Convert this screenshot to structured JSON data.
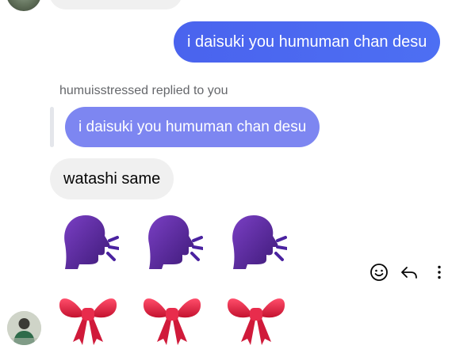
{
  "conversation": {
    "outgoing_message": "i daisuki you humuman chan desu",
    "reply_header": "humuisstressed replied to you",
    "quoted_message": "i daisuki you humuman chan desu",
    "incoming_message": "watashi same",
    "emoji_rows": [
      [
        "speaking-head-emoji",
        "speaking-head-emoji",
        "speaking-head-emoji"
      ],
      [
        "ribbon-bow-emoji",
        "ribbon-bow-emoji",
        "ribbon-bow-emoji"
      ]
    ]
  },
  "message_actions": [
    "smiley-react-icon",
    "reply-arrow-icon",
    "more-options-icon"
  ],
  "colors": {
    "outgoing_bubble": "#4c6ef5",
    "quoted_bubble": "#7d86f1",
    "incoming_bubble": "#f0f0f0",
    "speaking_head": "#5b2a9c",
    "ribbon": "#e02b4a"
  }
}
